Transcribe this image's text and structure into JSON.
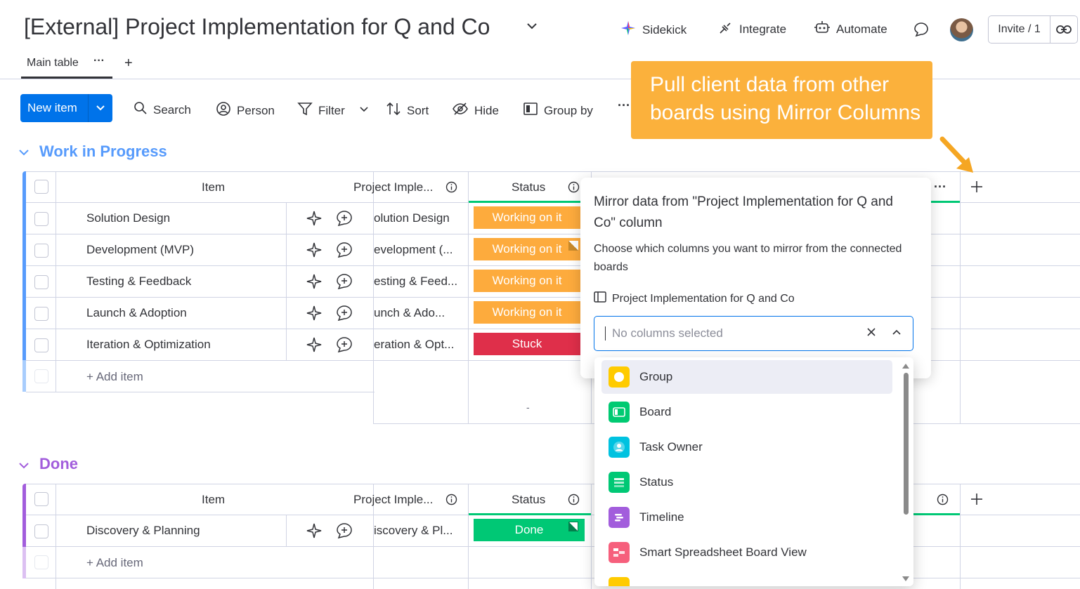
{
  "header": {
    "title": "[External] Project Implementation for Q and Co",
    "sidekick": "Sidekick",
    "integrate": "Integrate",
    "automate": "Automate",
    "invite": "Invite / 1"
  },
  "tabs": {
    "main": "Main table",
    "more": "···",
    "add": "+"
  },
  "toolbar": {
    "new_item": "New item",
    "search": "Search",
    "person": "Person",
    "filter": "Filter",
    "sort": "Sort",
    "hide": "Hide",
    "group_by": "Group by",
    "more": "···"
  },
  "groups": {
    "wip": {
      "title": "Work in Progress",
      "color": "#579bfc",
      "columns": {
        "item": "Item",
        "mirror": "Project Imple...",
        "status": "Status"
      },
      "rows": [
        {
          "name": "Solution Design",
          "mirror": "olution Design",
          "status": "Working on it"
        },
        {
          "name": "Development (MVP)",
          "mirror": "evelopment (...",
          "status": "Working on it"
        },
        {
          "name": "Testing & Feedback",
          "mirror": "esting & Feed...",
          "status": "Working on it"
        },
        {
          "name": "Launch & Adoption",
          "mirror": "unch & Ado...",
          "status": "Working on it"
        },
        {
          "name": "Iteration & Optimization",
          "mirror": "eration & Opt...",
          "status": "Stuck"
        }
      ],
      "add_item": "+ Add item",
      "summary_dash": "-"
    },
    "done": {
      "title": "Done",
      "color": "#a25ddc",
      "columns": {
        "item": "Item",
        "mirror": "Project Imple...",
        "status": "Status"
      },
      "rows": [
        {
          "name": "Discovery & Planning",
          "mirror": "iscovery & Pl...",
          "status": "Done"
        }
      ],
      "add_item": "+ Add item"
    }
  },
  "status_colors": {
    "working": "#fdab3d",
    "stuck": "#df2f4a",
    "done": "#00c875"
  },
  "callout": {
    "line1": "Pull client data from other",
    "line2": "boards using Mirror Columns",
    "color": "#fbb13c"
  },
  "mirror_popover": {
    "title": "Mirror data from \"Project Implementation for Q and Co\" column",
    "description": "Choose which columns you want to mirror from the connected boards",
    "board_name": "Project Implementation for Q and Co",
    "select_placeholder": "No columns selected"
  },
  "dropdown": {
    "options": [
      {
        "label": "Group",
        "icon": "group-icon",
        "color": "#ffcb00"
      },
      {
        "label": "Board",
        "icon": "board-icon",
        "color": "#00ca72"
      },
      {
        "label": "Task Owner",
        "icon": "people-icon",
        "color": "#00c2e0"
      },
      {
        "label": "Status",
        "icon": "status-icon",
        "color": "#00c875"
      },
      {
        "label": "Timeline",
        "icon": "timeline-icon",
        "color": "#a25ddc"
      },
      {
        "label": "Smart Spreadsheet Board View",
        "icon": "spreadsheet-icon",
        "color": "#f65f7c"
      }
    ]
  }
}
